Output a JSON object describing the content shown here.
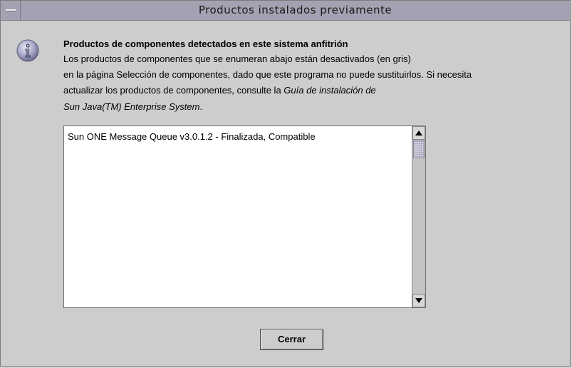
{
  "window": {
    "title": "Productos instalados previamente",
    "menu_icon": "window-menu-icon"
  },
  "message": {
    "icon": "info-icon",
    "heading": "Productos de componentes detectados en este sistema anfitrión",
    "line1": "Los productos de componentes que se enumeran abajo están desactivados (en gris)",
    "line2": "en la página Selección de componentes, dado que este programa no puede sustituirlos. Si necesita",
    "line3_prefix": "actualizar los productos de componentes, consulte la ",
    "line3_italic": "Guía de instalación de",
    "line4_italic": "Sun Java(TM) Enterprise System",
    "line4_suffix": "."
  },
  "product_list": {
    "items": [
      "Sun ONE Message Queue v3.0.1.2 - Finalizada, Compatible"
    ]
  },
  "buttons": {
    "close_label": "Cerrar"
  },
  "colors": {
    "titlebar": "#a2a2b2",
    "background": "#cdcdcd",
    "list_background": "#ffffff"
  }
}
